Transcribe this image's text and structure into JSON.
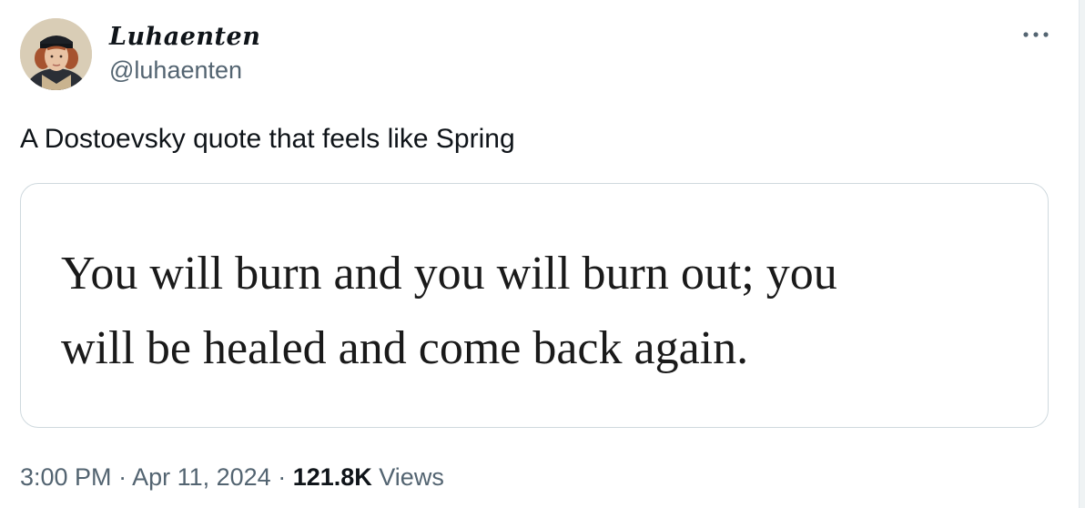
{
  "author": {
    "display_name": "Luhaenten",
    "handle": "@luhaenten",
    "avatar_icon": "portrait-avatar"
  },
  "menu": {
    "more_icon": "more-horizontal-icon",
    "more_label": "···"
  },
  "tweet": {
    "text": "A Dostoevsky quote that feels like Spring",
    "media_quote": "You will burn and you will burn out; you\nwill be healed and come back again."
  },
  "meta": {
    "time": "3:00 PM",
    "separator_1": " · ",
    "date": "Apr 11, 2024",
    "separator_2": " · ",
    "views_count": "121.8K",
    "views_label": " Views"
  },
  "colors": {
    "text_primary": "#0f1419",
    "text_secondary": "#536471",
    "border": "#cfd9de"
  }
}
